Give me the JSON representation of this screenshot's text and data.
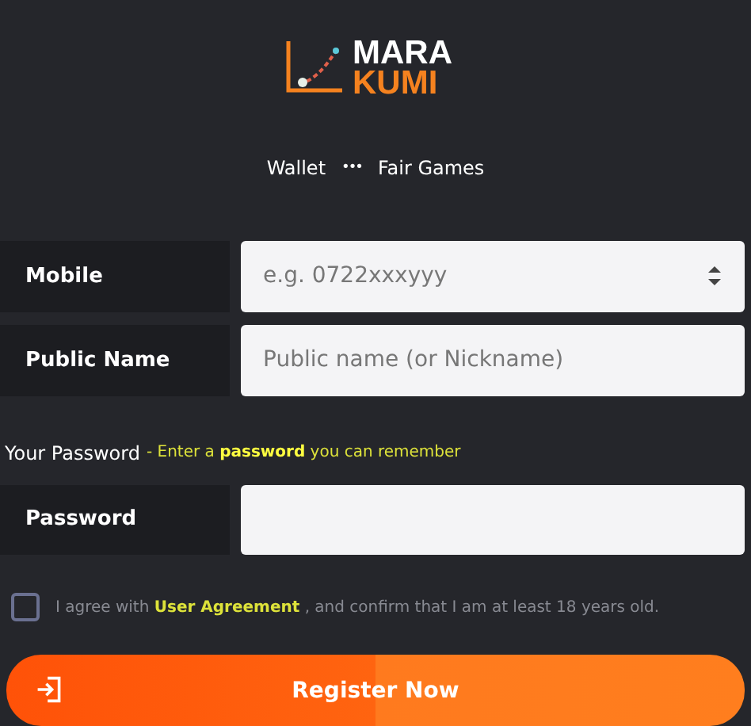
{
  "logo": {
    "line_1": "MARA",
    "line_2": "KUMI"
  },
  "nav": {
    "items": [
      "Wallet",
      "Fair Games"
    ],
    "separator": "•••"
  },
  "fields": [
    {
      "label": "Mobile",
      "placeholder": "e.g. 0722xxxyyy",
      "kind": "number"
    },
    {
      "label": "Public Name",
      "placeholder": "Public name (or Nickname)",
      "kind": "text"
    }
  ],
  "password_heading": {
    "title": "Your Password",
    "hint": "- Enter a **password** you can remember"
  },
  "password_field": {
    "label": "Password"
  },
  "agreement": {
    "checked": false,
    "text_before": "I agree with",
    "link": "User Agreement",
    "text_after": ", and confirm that I am at least 18 years old."
  },
  "register_button": {
    "label": "Register Now"
  }
}
